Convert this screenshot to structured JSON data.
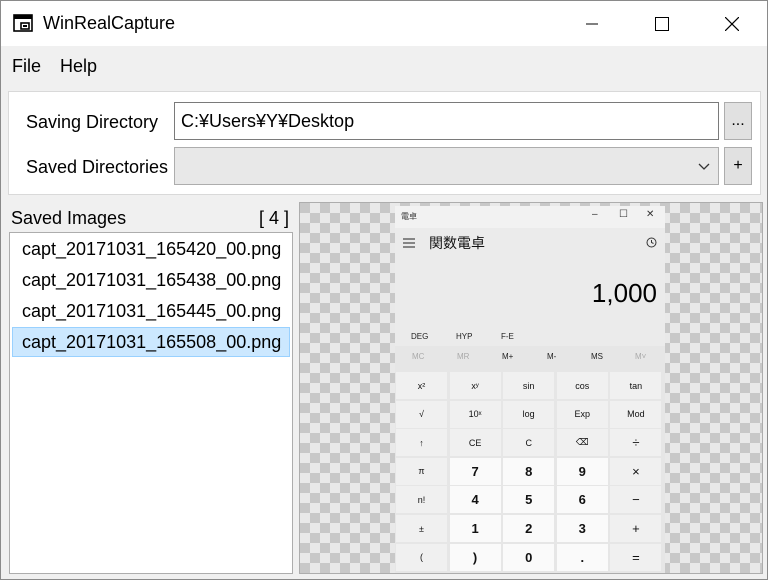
{
  "window": {
    "title": "WinRealCapture"
  },
  "menu": {
    "file": "File",
    "help": "Help"
  },
  "directory": {
    "saving_label": "Saving Directory",
    "saving_value": "C:¥Users¥Y¥Desktop",
    "browse_label": "...",
    "saved_label": "Saved Directories",
    "saved_value": "",
    "add_label": "+"
  },
  "images": {
    "label": "Saved Images",
    "count": "[ 4 ]",
    "items": [
      "capt_20171031_165420_00.png",
      "capt_20171031_165438_00.png",
      "capt_20171031_165445_00.png",
      "capt_20171031_165508_00.png"
    ],
    "selected_index": 3
  },
  "preview": {
    "calc": {
      "title": "電卓",
      "mode": "関数電卓",
      "display": "1,000",
      "angle_row": [
        "DEG",
        "HYP",
        "F-E"
      ],
      "memory_row": [
        "MC",
        "MR",
        "M+",
        "M-",
        "MS",
        "M˅"
      ],
      "buttons": [
        [
          "x²",
          "xʸ",
          "sin",
          "cos",
          "tan"
        ],
        [
          "√",
          "10ˣ",
          "log",
          "Exp",
          "Mod"
        ],
        [
          "↑",
          "CE",
          "C",
          "⌫",
          "÷"
        ],
        [
          "π",
          "7",
          "8",
          "9",
          "×"
        ],
        [
          "n!",
          "4",
          "5",
          "6",
          "−"
        ],
        [
          "±",
          "1",
          "2",
          "3",
          "+"
        ],
        [
          "(",
          ")",
          "0",
          ".",
          "="
        ]
      ]
    }
  }
}
